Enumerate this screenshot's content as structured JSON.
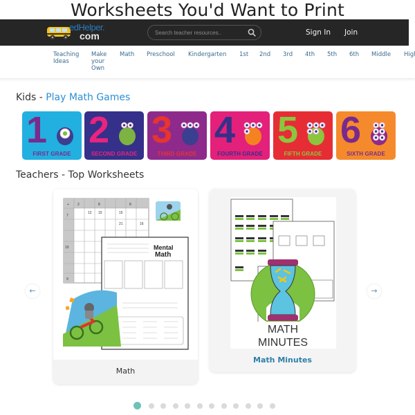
{
  "banner": {
    "title": "Worksheets You'd Want to Print"
  },
  "navbar": {
    "logo": {
      "top": "edHelper.",
      "bottom": "com"
    },
    "search": {
      "placeholder": "Search teacher resources..",
      "value": ""
    },
    "sign_in": "Sign In",
    "join": "Join"
  },
  "menu": {
    "items": [
      {
        "label": "Teaching Ideas"
      },
      {
        "label": "Make your Own"
      },
      {
        "label": "Math"
      },
      {
        "label": "Preschool"
      },
      {
        "label": "Kindergarten"
      },
      {
        "label": "1st"
      },
      {
        "label": "2nd"
      },
      {
        "label": "3rd"
      },
      {
        "label": "4th"
      },
      {
        "label": "5th"
      },
      {
        "label": "6th"
      },
      {
        "label": "Middle"
      },
      {
        "label": "High"
      }
    ]
  },
  "kids": {
    "prefix": "Kids - ",
    "link": "Play Math Games",
    "grades": [
      {
        "number": "1",
        "label": "FIRST GRADE",
        "bg": "#22b0e0",
        "num_color": "#7a2a8c",
        "label_color": "#7a2a8c",
        "monster": "#3a3f8f"
      },
      {
        "number": "2",
        "label": "SECOND GRADE",
        "bg": "#35308a",
        "num_color": "#e8247e",
        "label_color": "#e8247e",
        "monster": "#7cb342"
      },
      {
        "number": "3",
        "label": "THIRD GRADE",
        "bg": "#8e2a8c",
        "num_color": "#e8342e",
        "label_color": "#e8342e",
        "monster": "#3a3f8f"
      },
      {
        "number": "4",
        "label": "FOURTH GRADE",
        "bg": "#e3207a",
        "num_color": "#35308a",
        "label_color": "#35308a",
        "monster": "#f58220"
      },
      {
        "number": "5",
        "label": "FIFTH GRADE",
        "bg": "#e62d35",
        "num_color": "#8cc63f",
        "label_color": "#8cc63f",
        "monster": "#8cc63f"
      },
      {
        "number": "6",
        "label": "SIXTH GRADE",
        "bg": "#f58a2c",
        "num_color": "#7a2a8c",
        "label_color": "#7a2a8c",
        "monster": "#8e2a8c"
      }
    ]
  },
  "teachers": {
    "title": "Teachers - Top Worksheets",
    "cards": [
      {
        "caption": "Math",
        "caption_color": "#333333"
      },
      {
        "caption": "Math Minutes",
        "caption_color": "#2f7fa8",
        "logo_line1": "MATH",
        "logo_line2": "MINUTES"
      }
    ],
    "prev_arrow": "←",
    "next_arrow": "→"
  },
  "carousel": {
    "total_pages": 12,
    "active_page": 1
  }
}
